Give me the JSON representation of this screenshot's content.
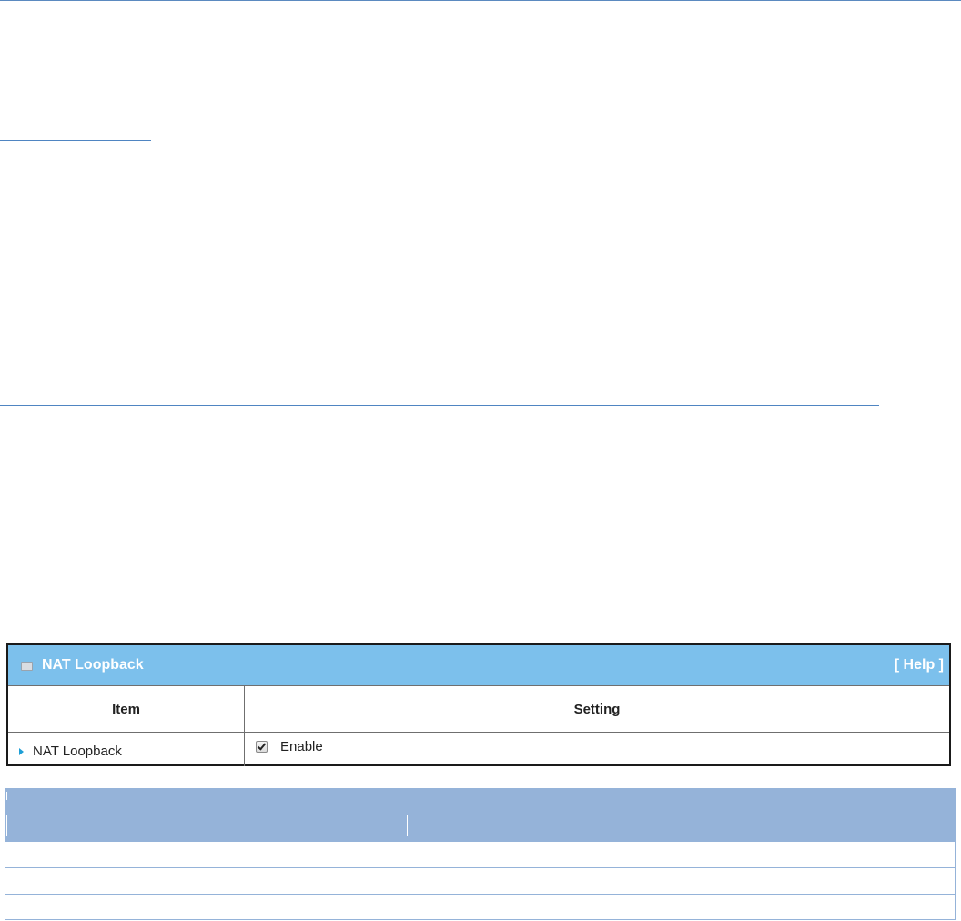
{
  "panel": {
    "title": "NAT Loopback",
    "help_label": "[ Help ]",
    "accent_color": "#7cc0ec",
    "columns": {
      "item": "Item",
      "setting": "Setting"
    },
    "rows": [
      {
        "label": "NAT Loopback",
        "checkbox_checked": true,
        "checkbox_label": "Enable"
      }
    ]
  },
  "grid": {
    "header_color": "#95b3d9",
    "row_count": 3
  }
}
